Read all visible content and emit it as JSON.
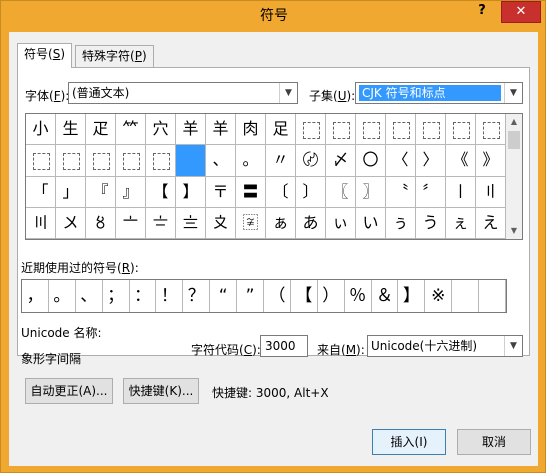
{
  "window": {
    "title": "符号",
    "help": "?",
    "close": "✕"
  },
  "tabs": [
    {
      "label": "符号",
      "key": "S"
    },
    {
      "label": "特殊字符",
      "key": "P"
    }
  ],
  "font": {
    "label_pre": "字体(",
    "key": "F",
    "label_post": "):",
    "value": "(普通文本)"
  },
  "subset": {
    "label_pre": "子集(",
    "key": "U",
    "label_post": "):",
    "value": "CJK 符号和标点"
  },
  "grid": {
    "rows": [
      [
        "⼩",
        "⽣",
        "⽦",
        "⺮",
        "⽳",
        "⽺",
        "⽺",
        "⾁",
        "⾜",
        "",
        "",
        "",
        "",
        "",
        "",
        ""
      ],
      [
        "",
        "",
        "",
        "",
        "",
        "",
        "、",
        "。",
        "〃",
        "〄",
        "〆",
        "〇",
        "〈",
        "〉",
        "《",
        "》"
      ],
      [
        "「",
        "」",
        "『",
        "』",
        "【",
        "】",
        "〒",
        "〓",
        "〔",
        "〕",
        "〖",
        "〗",
        "〝",
        "〞",
        "〡",
        "〢"
      ],
      [
        "〣",
        "〤",
        "〥",
        "〦",
        "〧",
        "〨",
        "〩",
        "〾",
        "ぁ",
        "あ",
        "ぃ",
        "い",
        "ぅ",
        "う",
        "ぇ",
        "え"
      ]
    ]
  },
  "recent": {
    "label_pre": "近期使用过的符号(",
    "key": "R",
    "label_post": "):",
    "items": [
      "，",
      "。",
      "、",
      "；",
      "：",
      "！",
      "？",
      "“",
      "”",
      "（",
      "【",
      "）",
      "％",
      "＆",
      "】",
      "※",
      "",
      ""
    ]
  },
  "unicode_name_label": "Unicode 名称:",
  "char_name": "象形字间隔",
  "charcode": {
    "label_pre": "字符代码(",
    "key": "C",
    "label_post": "):",
    "value": "3000"
  },
  "from": {
    "label_pre": "来自(",
    "key": "M",
    "label_post": "):",
    "value": "Unicode(十六进制)"
  },
  "buttons": {
    "autocorrect": "自动更正(A)...",
    "shortcut_key": "快捷键(K)...",
    "insert": "插入(I)",
    "cancel": "取消"
  },
  "shortcut_text": "快捷键: 3000, Alt+X"
}
